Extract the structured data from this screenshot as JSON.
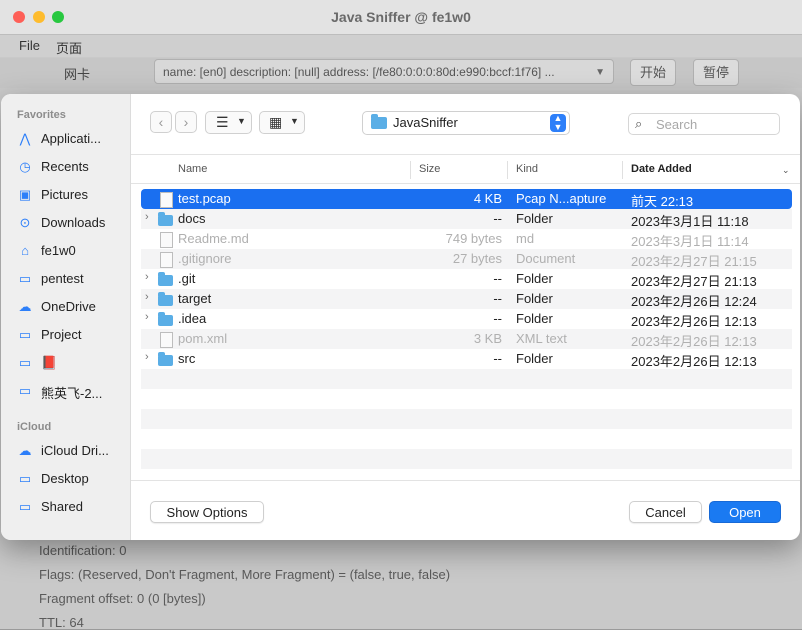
{
  "window": {
    "title": "Java Sniffer @ fe1w0"
  },
  "menu": {
    "file": "File",
    "page": "页面"
  },
  "controls": {
    "nic_label": "网卡",
    "nic_value": "name: [en0] description: [null] address: [/fe80:0:0:0:80d:e990:bccf:1f76] ...",
    "start": "开始",
    "pause": "暂停"
  },
  "details": [
    "Identification: 0",
    "Flags: (Reserved, Don't Fragment, More Fragment) = (false, true, false)",
    "Fragment offset: 0 (0 [bytes])",
    "TTL: 64"
  ],
  "sidebar": {
    "favorites_heading": "Favorites",
    "favorites": [
      {
        "label": "Applicati...",
        "icon": "applications-icon",
        "glyph": "⋀"
      },
      {
        "label": "Recents",
        "icon": "clock-icon",
        "glyph": "◷"
      },
      {
        "label": "Pictures",
        "icon": "pictures-icon",
        "glyph": "▣"
      },
      {
        "label": "Downloads",
        "icon": "downloads-icon",
        "glyph": "⊙"
      },
      {
        "label": "fe1w0",
        "icon": "home-icon",
        "glyph": "⌂"
      },
      {
        "label": "pentest",
        "icon": "folder-icon",
        "glyph": "▭"
      },
      {
        "label": "OneDrive",
        "icon": "cloud-icon",
        "glyph": "☁"
      },
      {
        "label": "Project",
        "icon": "folder-icon",
        "glyph": "▭"
      },
      {
        "label": "📕",
        "icon": "folder-icon",
        "glyph": "▭"
      },
      {
        "label": "熊英飞-2...",
        "icon": "folder-icon",
        "glyph": "▭"
      }
    ],
    "icloud_heading": "iCloud",
    "icloud": [
      {
        "label": "iCloud Dri...",
        "icon": "icloud-icon",
        "glyph": "☁"
      },
      {
        "label": "Desktop",
        "icon": "desktop-icon",
        "glyph": "▭"
      },
      {
        "label": "Shared",
        "icon": "shared-folder-icon",
        "glyph": "▭"
      }
    ]
  },
  "toolbar": {
    "location": "JavaSniffer",
    "search_placeholder": "Search"
  },
  "columns": {
    "name": "Name",
    "size": "Size",
    "kind": "Kind",
    "date": "Date Added"
  },
  "files": [
    {
      "name": "test.pcap",
      "size": "4 KB",
      "kind": "Pcap N...apture",
      "date": "前天 22:13",
      "type": "doc",
      "state": "selected",
      "expandable": false
    },
    {
      "name": "docs",
      "size": "--",
      "kind": "Folder",
      "date": "2023年3月1日 11:18",
      "type": "folder",
      "state": "normal",
      "expandable": true
    },
    {
      "name": "Readme.md",
      "size": "749 bytes",
      "kind": "md",
      "date": "2023年3月1日 11:14",
      "type": "doc",
      "state": "dim",
      "expandable": false
    },
    {
      "name": ".gitignore",
      "size": "27 bytes",
      "kind": "Document",
      "date": "2023年2月27日 21:15",
      "type": "doc",
      "state": "dim",
      "expandable": false
    },
    {
      "name": ".git",
      "size": "--",
      "kind": "Folder",
      "date": "2023年2月27日 21:13",
      "type": "folder",
      "state": "normal",
      "expandable": true
    },
    {
      "name": "target",
      "size": "--",
      "kind": "Folder",
      "date": "2023年2月26日 12:24",
      "type": "folder",
      "state": "normal",
      "expandable": true
    },
    {
      "name": ".idea",
      "size": "--",
      "kind": "Folder",
      "date": "2023年2月26日 12:13",
      "type": "folder",
      "state": "normal",
      "expandable": true
    },
    {
      "name": "pom.xml",
      "size": "3 KB",
      "kind": "XML text",
      "date": "2023年2月26日 12:13",
      "type": "doc",
      "state": "dim",
      "expandable": false
    },
    {
      "name": "src",
      "size": "--",
      "kind": "Folder",
      "date": "2023年2月26日 12:13",
      "type": "folder",
      "state": "normal",
      "expandable": true
    }
  ],
  "footer": {
    "show_options": "Show Options",
    "cancel": "Cancel",
    "open": "Open"
  }
}
